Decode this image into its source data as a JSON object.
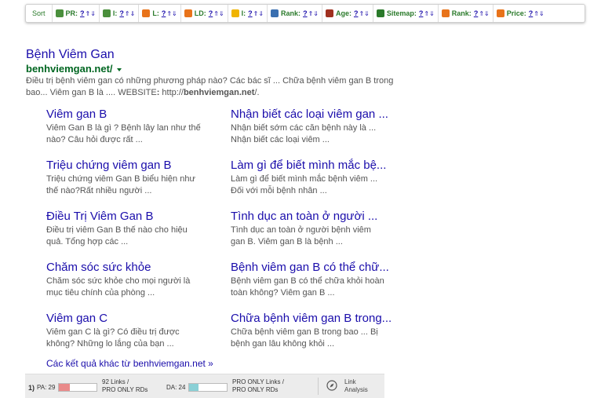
{
  "toolbar": {
    "sort_label": "Sort",
    "items": [
      {
        "label": "PR:",
        "value": "?",
        "icon": "google-pr-icon",
        "color": "#4a8f3c"
      },
      {
        "label": "I:",
        "value": "?",
        "icon": "google-index-icon",
        "color": "#4a8f3c"
      },
      {
        "label": "L:",
        "value": "?",
        "icon": "links-icon",
        "color": "#e8731a"
      },
      {
        "label": "LD:",
        "value": "?",
        "icon": "link-domains-icon",
        "color": "#e8731a"
      },
      {
        "label": "I:",
        "value": "?",
        "icon": "bing-index-icon",
        "color": "#f0b400"
      },
      {
        "label": "Rank:",
        "value": "?",
        "icon": "alexa-rank-icon",
        "color": "#3a6fb0"
      },
      {
        "label": "Age:",
        "value": "?",
        "icon": "age-icon",
        "color": "#a03020"
      },
      {
        "label": "Sitemap:",
        "value": "?",
        "icon": "sitemap-icon",
        "color": "#2a7a2a"
      },
      {
        "label": "Rank:",
        "value": "?",
        "icon": "semrush-rank-icon",
        "color": "#e8731a"
      },
      {
        "label": "Price:",
        "value": "?",
        "icon": "price-icon",
        "color": "#e8731a"
      }
    ],
    "arrows": "⇑⇓"
  },
  "result": {
    "title": "Bệnh Viêm Gan",
    "url": "benhviemgan.net/",
    "desc_1": "Điều trị bệnh viêm gan có những phương pháp nào? Các bác sĩ ... Chữa bệnh viêm gan B trong bao... Viêm gan B là .... WEBSITE",
    "desc_colon": ":",
    "desc_2": " http://",
    "desc_domain": "benhviemgan.net",
    "desc_3": "/."
  },
  "sitelinks": [
    {
      "title": "Viêm gan B",
      "snippet": "Viêm Gan B là gì ? Bệnh lây lan như thế nào? Câu hỏi được rất ..."
    },
    {
      "title": "Nhận biết các loại viêm gan ...",
      "snippet": "Nhận biết sớm các căn bệnh này là ... Nhận biết các loại viêm ..."
    },
    {
      "title": "Triệu chứng viêm gan B",
      "snippet": "Triệu chứng viêm Gan B biểu hiện như thế nào?Rất nhiều người ..."
    },
    {
      "title": "Làm gì để biết mình mắc bệ...",
      "snippet": "Làm gì để biết mình mắc bệnh viêm ... Đối với mỗi bệnh nhân ..."
    },
    {
      "title": "Điều Trị Viêm Gan B",
      "snippet": "Điều trị viêm Gan B thế nào cho hiệu quả. Tổng hợp các ..."
    },
    {
      "title": "Tình dục an toàn ở người ...",
      "snippet": "Tình dục an toàn ở người bệnh viêm gan B. Viêm gan B là bệnh ..."
    },
    {
      "title": "Chăm sóc sức khỏe",
      "snippet": "Chăm sóc sức khỏe cho mọi người là mục tiêu chính của phòng ..."
    },
    {
      "title": "Bệnh viêm gan B có thể chữ...",
      "snippet": "Bệnh viêm gan B có thể chữa khỏi hoàn toàn không? Viêm gan B ..."
    },
    {
      "title": "Viêm gan C",
      "snippet": "Viêm gan C là gì? Có điều trị được không? Những lo lắng của bạn ..."
    },
    {
      "title": "Chữa bệnh viêm gan B trong...",
      "snippet": "Chữa bệnh viêm gan B trong bao ... Bị bệnh gan lâu không khỏi ..."
    }
  ],
  "more_results": "Các kết quả khác từ benhviemgan.net »",
  "mozbar": {
    "rank": "1)",
    "pa_label": "PA: 29",
    "pa_value": 29,
    "links_line1": "92 Links /",
    "links_line2": "PRO ONLY RDs",
    "da_label": "DA: 24",
    "da_value": 24,
    "pro_line1": "PRO ONLY Links /",
    "pro_line2": "PRO ONLY RDs",
    "link_analysis_1": "Link",
    "link_analysis_2": "Analysis"
  }
}
